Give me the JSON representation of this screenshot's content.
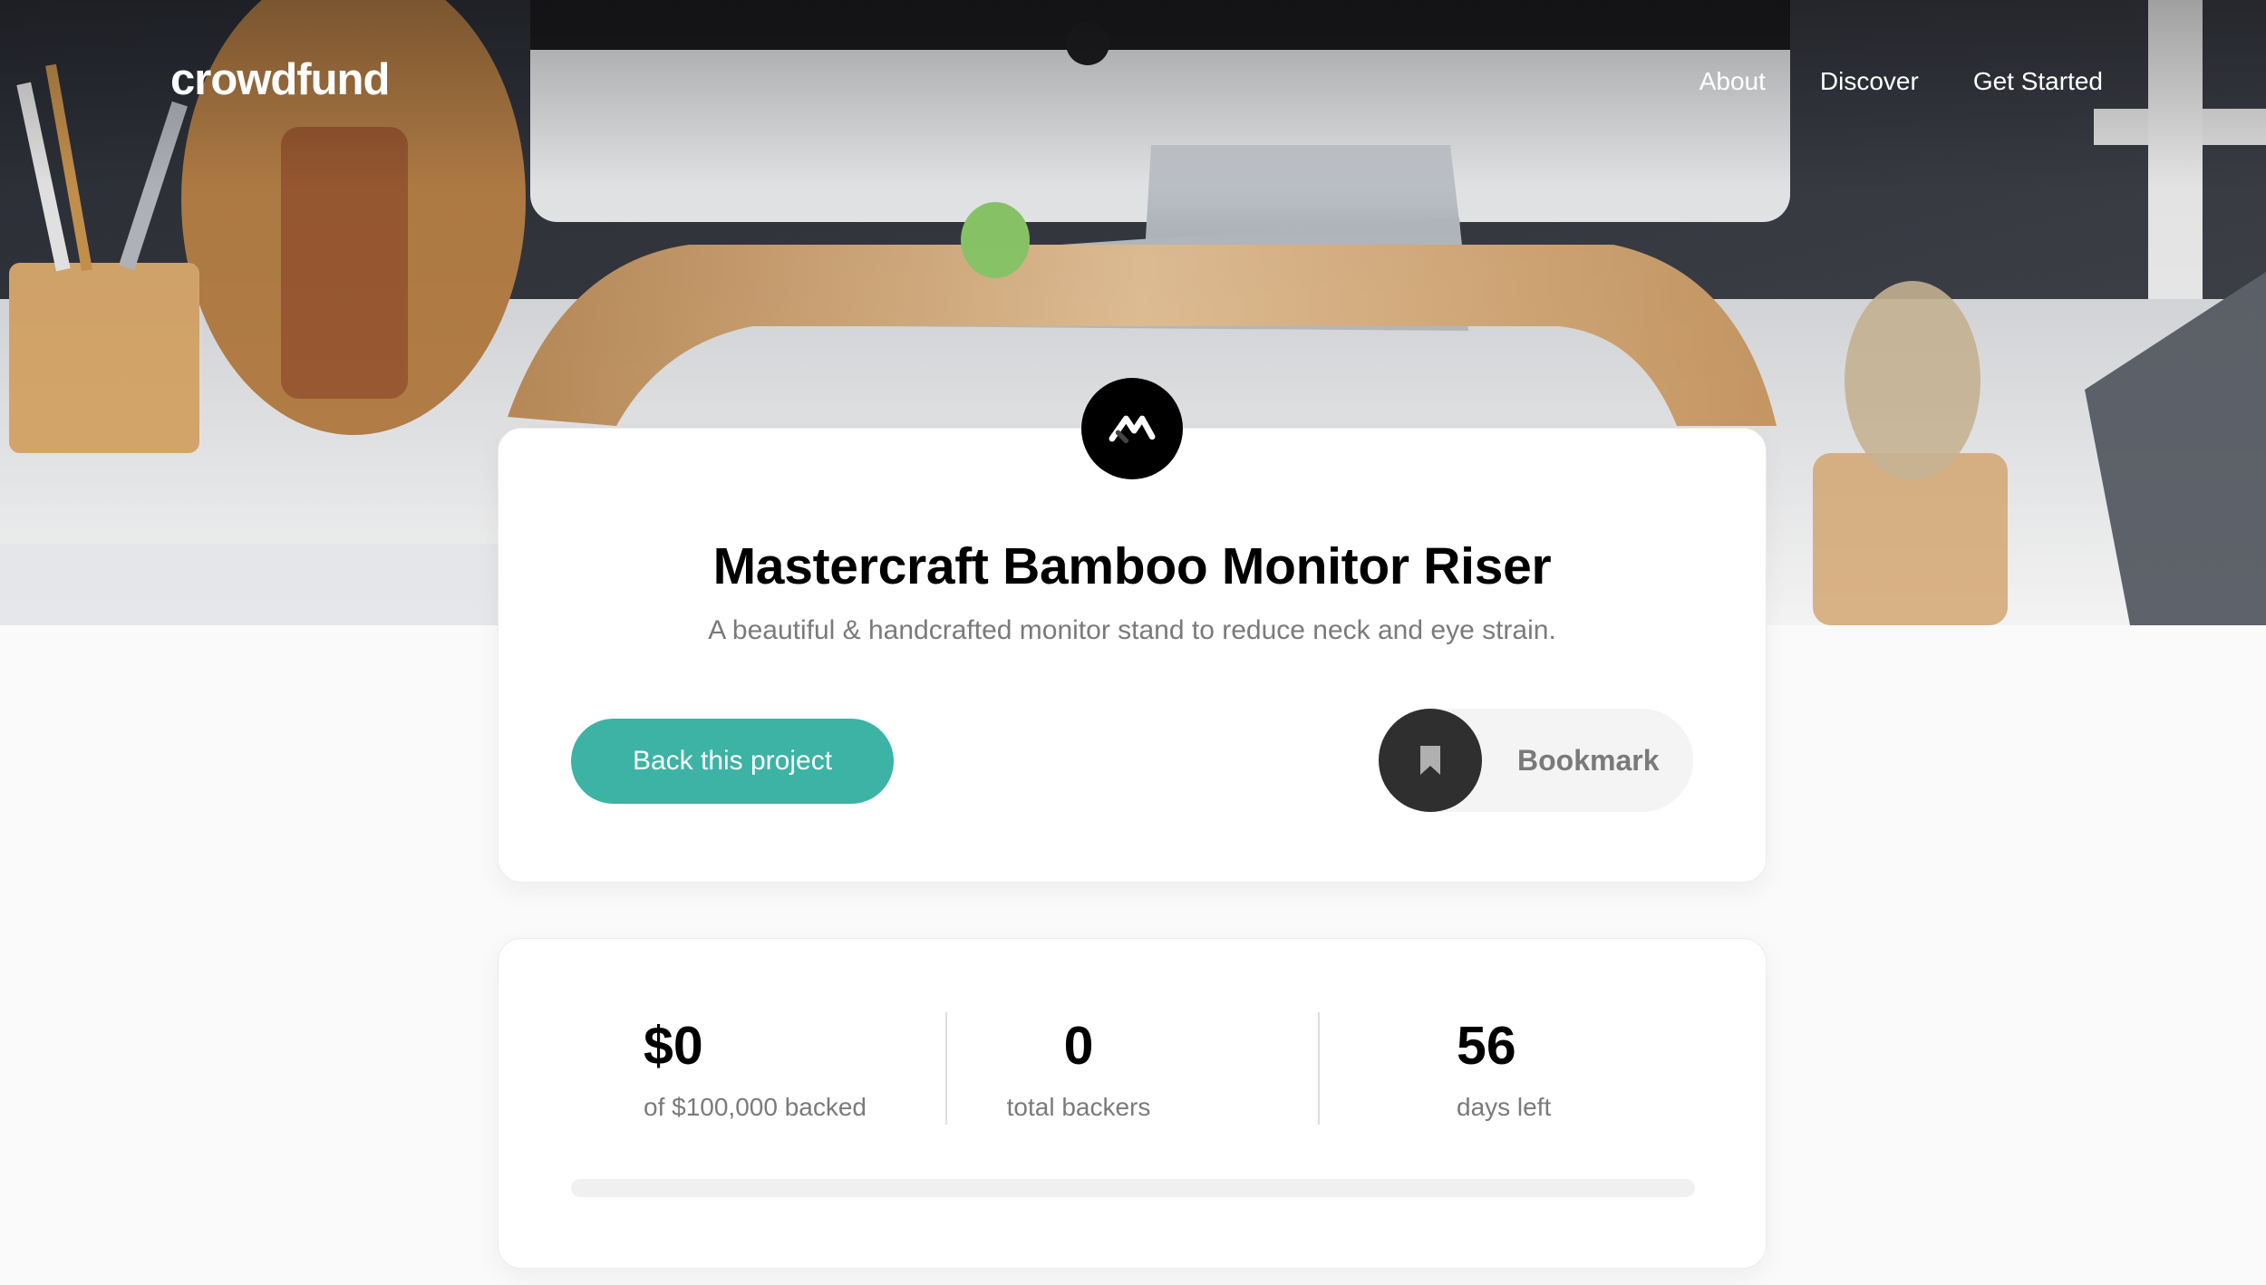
{
  "header": {
    "logo": "crowdfund",
    "nav": [
      {
        "label": "About"
      },
      {
        "label": "Discover"
      },
      {
        "label": "Get Started"
      }
    ]
  },
  "project": {
    "title": "Mastercraft Bamboo Monitor Riser",
    "subtitle": "A beautiful & handcrafted monitor stand to reduce neck and eye strain.",
    "back_button": "Back this project",
    "bookmark_label": "Bookmark"
  },
  "stats": {
    "backed_amount": "$0",
    "backed_caption": "of $100,000 backed",
    "backers_count": "0",
    "backers_caption": "total backers",
    "days_left": "56",
    "days_caption": "days left",
    "progress_fraction": 0
  },
  "colors": {
    "accent": "#3cb3a5",
    "dark": "#2f2f2f",
    "muted_text": "#7a7a7a"
  },
  "icons": {
    "brand": "mastercraft-logo-icon",
    "bookmark": "bookmark-icon"
  }
}
